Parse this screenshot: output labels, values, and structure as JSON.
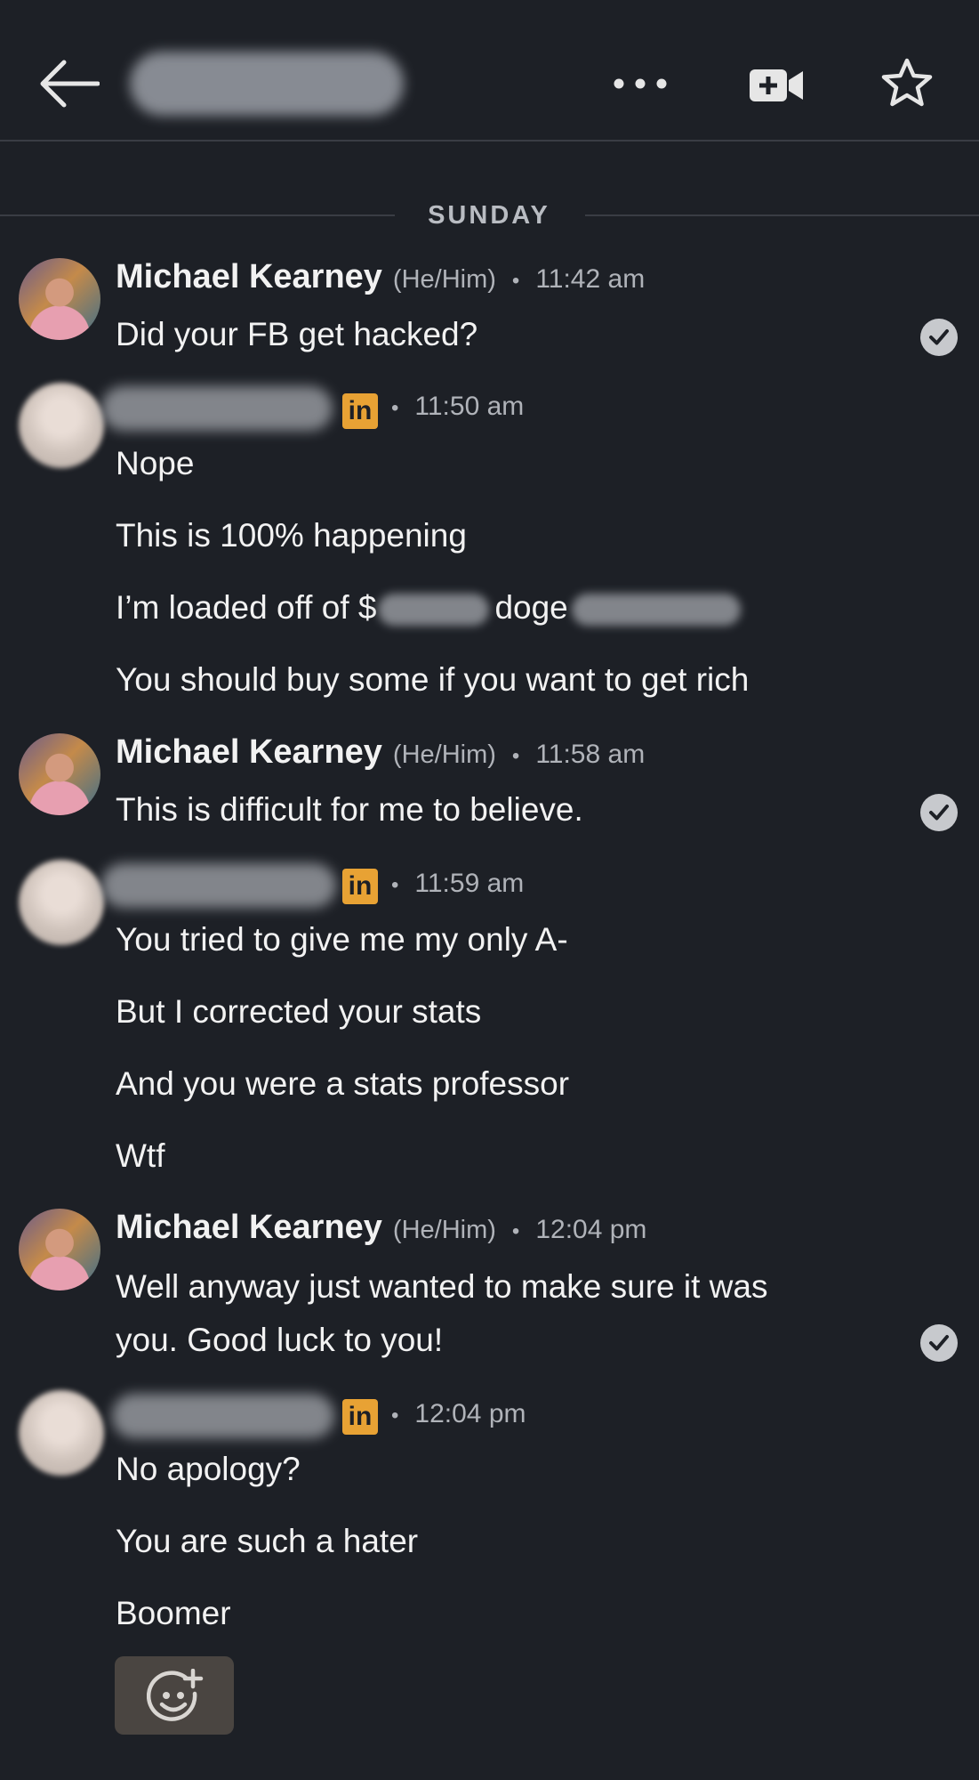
{
  "header": {
    "back_icon": "arrow-left-icon",
    "more_icon": "more-horizontal-icon",
    "video_icon": "video-add-icon",
    "star_icon": "star-outline-icon"
  },
  "day_separator": "SUNDAY",
  "messages": [
    {
      "sender": "Michael Kearney",
      "pronouns": "(He/Him)",
      "dot": "•",
      "time": "11:42 am",
      "lines": [
        "Did your FB get hacked?"
      ],
      "read": true
    },
    {
      "sender": "",
      "badge": "in",
      "dot": "•",
      "time": "11:50 am",
      "lines": [
        "Nope",
        "This is 100% happening",
        {
          "pre": "I’m loaded off of $",
          "mid": "doge"
        },
        "You should buy some if you want to get rich"
      ]
    },
    {
      "sender": "Michael Kearney",
      "pronouns": "(He/Him)",
      "dot": "•",
      "time": "11:58 am",
      "lines": [
        "This is difficult for me to believe."
      ],
      "read": true
    },
    {
      "sender": "",
      "badge": "in",
      "dot": "•",
      "time": "11:59 am",
      "lines": [
        "You tried to give me my only A-",
        "But I corrected your stats",
        "And you were a stats professor",
        "Wtf"
      ]
    },
    {
      "sender": "Michael Kearney",
      "pronouns": "(He/Him)",
      "dot": "•",
      "time": "12:04 pm",
      "lines": [
        "Well anyway just wanted to make sure it was",
        "you. Good luck to you!"
      ],
      "read": true
    },
    {
      "sender": "",
      "badge": "in",
      "dot": "•",
      "time": "12:04 pm",
      "lines": [
        "No apology?",
        "You are such a hater",
        "Boomer"
      ]
    }
  ],
  "reaction_button_icon": "emoji-add-icon",
  "colors": {
    "background": "#1d2026",
    "text": "#f2f2f2",
    "muted": "#b0b3b9",
    "linkedin_badge": "#e8a234",
    "reaction_bg": "#4a4541"
  }
}
